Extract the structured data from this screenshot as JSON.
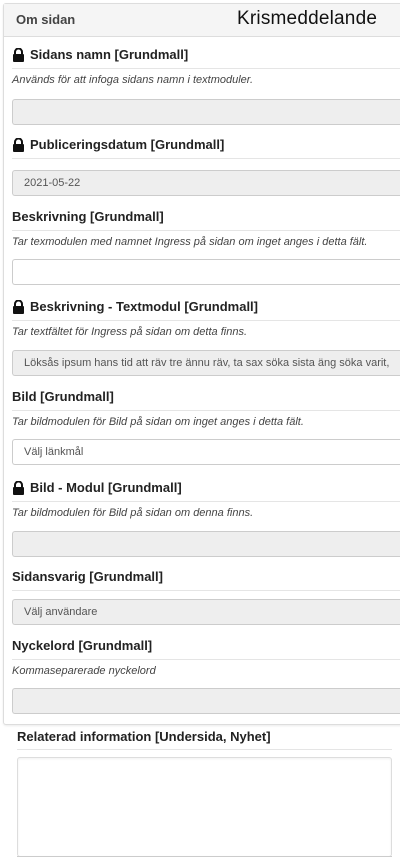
{
  "header": {
    "panel_title": "Om sidan",
    "overlay_title": "Krismeddelande"
  },
  "fields": [
    {
      "label": "Sidans namn [Grundmall]",
      "locked": true,
      "help": "Används för att infoga sidans namn i textmoduler.",
      "value": "",
      "placeholder": ""
    },
    {
      "label": "Publiceringsdatum [Grundmall]",
      "locked": true,
      "help": "",
      "value": "2021-05-22",
      "placeholder": ""
    },
    {
      "label": "Beskrivning [Grundmall]",
      "locked": false,
      "help": "Tar texmodulen med namnet Ingress på sidan om inget anges i detta fält.",
      "value": "",
      "placeholder": ""
    },
    {
      "label": "Beskrivning - Textmodul [Grundmall]",
      "locked": true,
      "help": "Tar textfältet för Ingress på sidan om detta finns.",
      "value": "Löksås ipsum hans tid att räv tre ännu räv, ta sax söka sista äng söka varit,",
      "placeholder": ""
    },
    {
      "label": "Bild [Grundmall]",
      "locked": false,
      "help": "Tar bildmodulen för Bild på sidan om inget anges i detta fält.",
      "value": "Välj länkmål",
      "placeholder": ""
    },
    {
      "label": "Bild - Modul [Grundmall]",
      "locked": true,
      "help": "Tar bildmodulen för Bild på sidan om denna finns.",
      "value": "",
      "placeholder": ""
    },
    {
      "label": "Sidansvarig [Grundmall]",
      "locked": false,
      "help": "",
      "value": "Välj användare",
      "placeholder": ""
    },
    {
      "label": "Nyckelord [Grundmall]",
      "locked": false,
      "help": "Kommaseparerade nyckelord",
      "value": "",
      "placeholder": ""
    }
  ],
  "related": {
    "label": "Relaterad information [Undersida, Nyhet]",
    "value": ""
  },
  "colors": {
    "disabled_bg": "#eeeeee",
    "border": "#cccccc",
    "header_bg": "#f5f5f5"
  }
}
